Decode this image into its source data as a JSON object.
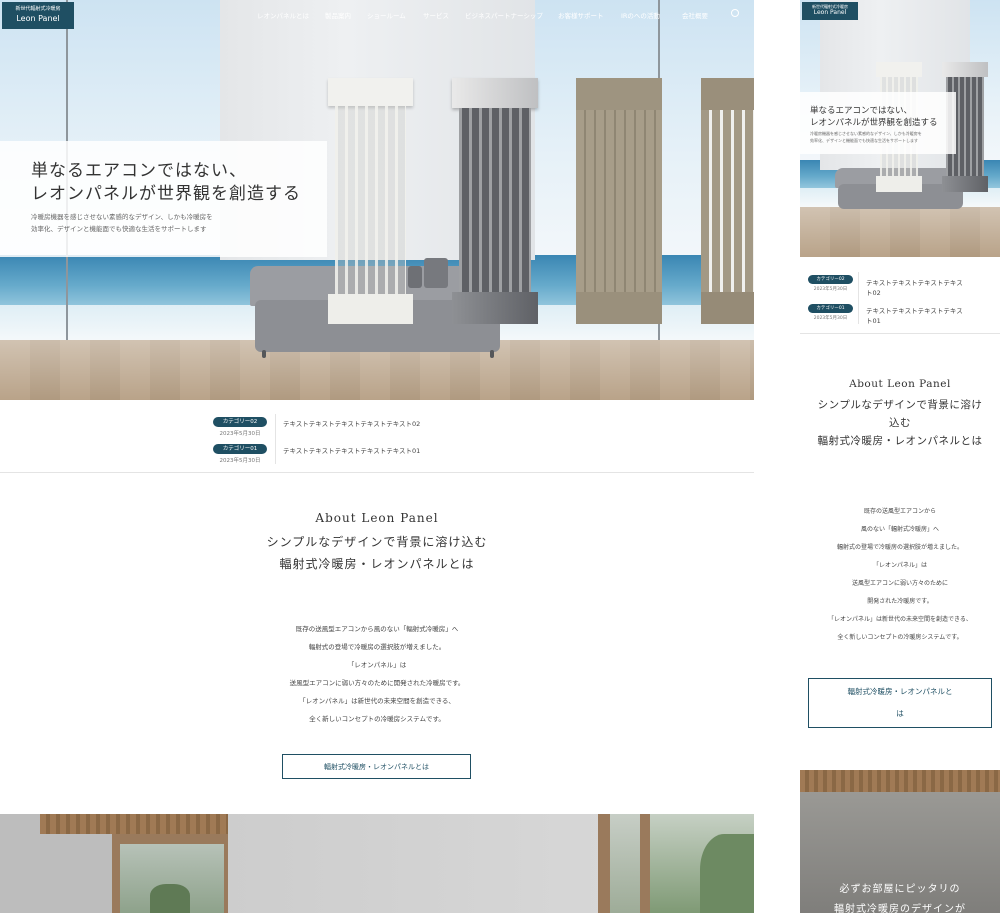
{
  "header": {
    "logo_small": "新世代輻射式冷暖房",
    "logo_brand": "Leon Panel",
    "nav": [
      "レオンパネルとは",
      "製品案内",
      "ショールーム",
      "サービス",
      "ビジネスパートナーシップ",
      "お客様サポート",
      "IRのへの活動",
      "会社概要"
    ]
  },
  "hero": {
    "title_line1": "単なるエアコンではない、",
    "title_line2": "レオンパネルが世界観を創造する",
    "sub_line1": "冷暖房機器を感じさせない素感的なデザイン、しかも冷暖房を",
    "sub_line2": "効率化、デザインと機能面でも快適な生活をサポートします"
  },
  "news": [
    {
      "category": "カテゴリー02",
      "date": "2023年5月30日",
      "text": "テキストテキストテキストテキストテキスト02"
    },
    {
      "category": "カテゴリー01",
      "date": "2023年5月30日",
      "text": "テキストテキストテキストテキストテキスト01"
    }
  ],
  "about": {
    "eyebrow": "About Leon Panel",
    "title_line1": "シンプルなデザインで背景に溶け込む",
    "title_line2": "輻射式冷暖房・レオンパネルとは",
    "body": [
      "既存の送風型エアコンから風のない「輻射式冷暖房」へ",
      "輻射式の登場で冷暖房の選択肢が増えました。",
      "「レオンパネル」は",
      "送風型エアコンに弱い方々のために開発された冷暖房です。",
      "「レオンパネル」は新世代の未来空間を創造できる、",
      "全く新しいコンセプトの冷暖房システムです。"
    ],
    "button": "輻射式冷暖房・レオンパネルとは"
  },
  "mobile": {
    "hero_title_line1": "単なるエアコンではない、",
    "hero_title_line2": "レオンパネルが世界観を創造する",
    "hero_sub_line1": "冷暖房機器を感じさせない素感的なデザイン、しかも冷暖房を",
    "hero_sub_line2": "効率化、デザインと機能面でも快適な生活をサポートします",
    "news": [
      {
        "category": "カテゴリー02",
        "date": "2023年5月30日",
        "text_line1": "テキストテキストテキストテキス",
        "text_line2": "ト02"
      },
      {
        "category": "カテゴリー01",
        "date": "2023年5月30日",
        "text_line1": "テキストテキストテキストテキス",
        "text_line2": "ト01"
      }
    ],
    "about_eyebrow": "About Leon Panel",
    "about_title": [
      "シンプルなデザインで背景に溶け",
      "込む",
      "輻射式冷暖房・レオンパネルとは"
    ],
    "about_body": [
      "既存の送風型エアコンから",
      "風のない「輻射式冷暖房」へ",
      "輻射式の登場で冷暖房の選択肢が増えました。",
      "「レオンパネル」は",
      "送風型エアコンに弱い方々のために",
      "開発された冷暖房です。",
      "「レオンパネル」は新世代の未来空間を創造できる、",
      "全く新しいコンセプトの冷暖房システムです。"
    ],
    "button_line1": "輻射式冷暖房・レオンパネルと",
    "button_line2": "は",
    "section2_line1": "必ずお部屋にピッタリの",
    "section2_line2": "輻射式冷暖房のデザインが"
  },
  "colors": {
    "brand": "#1f4f63",
    "accent_border": "#1f4f63"
  }
}
